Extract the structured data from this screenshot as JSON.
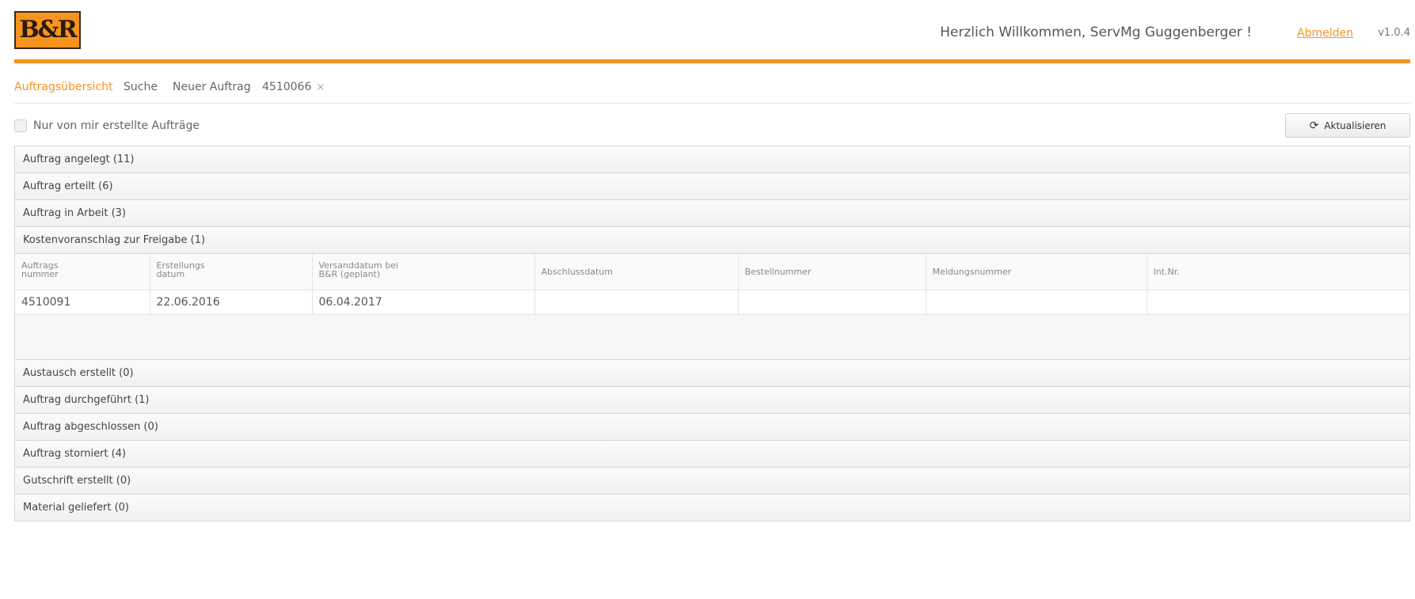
{
  "header": {
    "logo_text": "B&R",
    "welcome": "Herzlich Willkommen, ServMg Guggenberger !",
    "logout": "Abmelden",
    "version": "v1.0.4",
    "accent_color": "#f7931e"
  },
  "tabs": [
    {
      "label": "Auftragsübersicht",
      "active": true
    },
    {
      "label": "Suche"
    },
    {
      "label": "Neuer Auftrag"
    },
    {
      "label": "4510066",
      "closable": true,
      "close_icon": "×"
    }
  ],
  "toolbar": {
    "checkbox_label": "Nur von mir erstellte Aufträge",
    "checkbox_checked": false,
    "refresh_label": "Aktualisieren",
    "refresh_icon": "⟳"
  },
  "groups": [
    {
      "label": "Auftrag angelegt (11)"
    },
    {
      "label": "Auftrag erteilt (6)"
    },
    {
      "label": "Auftrag in Arbeit (3)"
    },
    {
      "label": "Kostenvoranschlag zur Freigabe (1)",
      "expanded": true
    },
    {
      "label": "Austausch erstellt (0)"
    },
    {
      "label": "Auftrag durchgeführt (1)"
    },
    {
      "label": "Auftrag abgeschlossen (0)"
    },
    {
      "label": "Auftrag storniert (4)"
    },
    {
      "label": "Gutschrift erstellt (0)"
    },
    {
      "label": "Material geliefert (0)"
    }
  ],
  "table": {
    "columns": [
      [
        "Auftrags",
        "nummer"
      ],
      [
        "Erstellungs",
        "datum"
      ],
      [
        "Versanddatum bei",
        "B&R (geplant)"
      ],
      [
        "Abschlussdatum"
      ],
      [
        "Bestellnummer"
      ],
      [
        "Meldungsnummer"
      ],
      [
        "Int.Nr."
      ]
    ],
    "rows": [
      [
        "4510091",
        "22.06.2016",
        "06.04.2017",
        "",
        "",
        "",
        ""
      ]
    ]
  }
}
